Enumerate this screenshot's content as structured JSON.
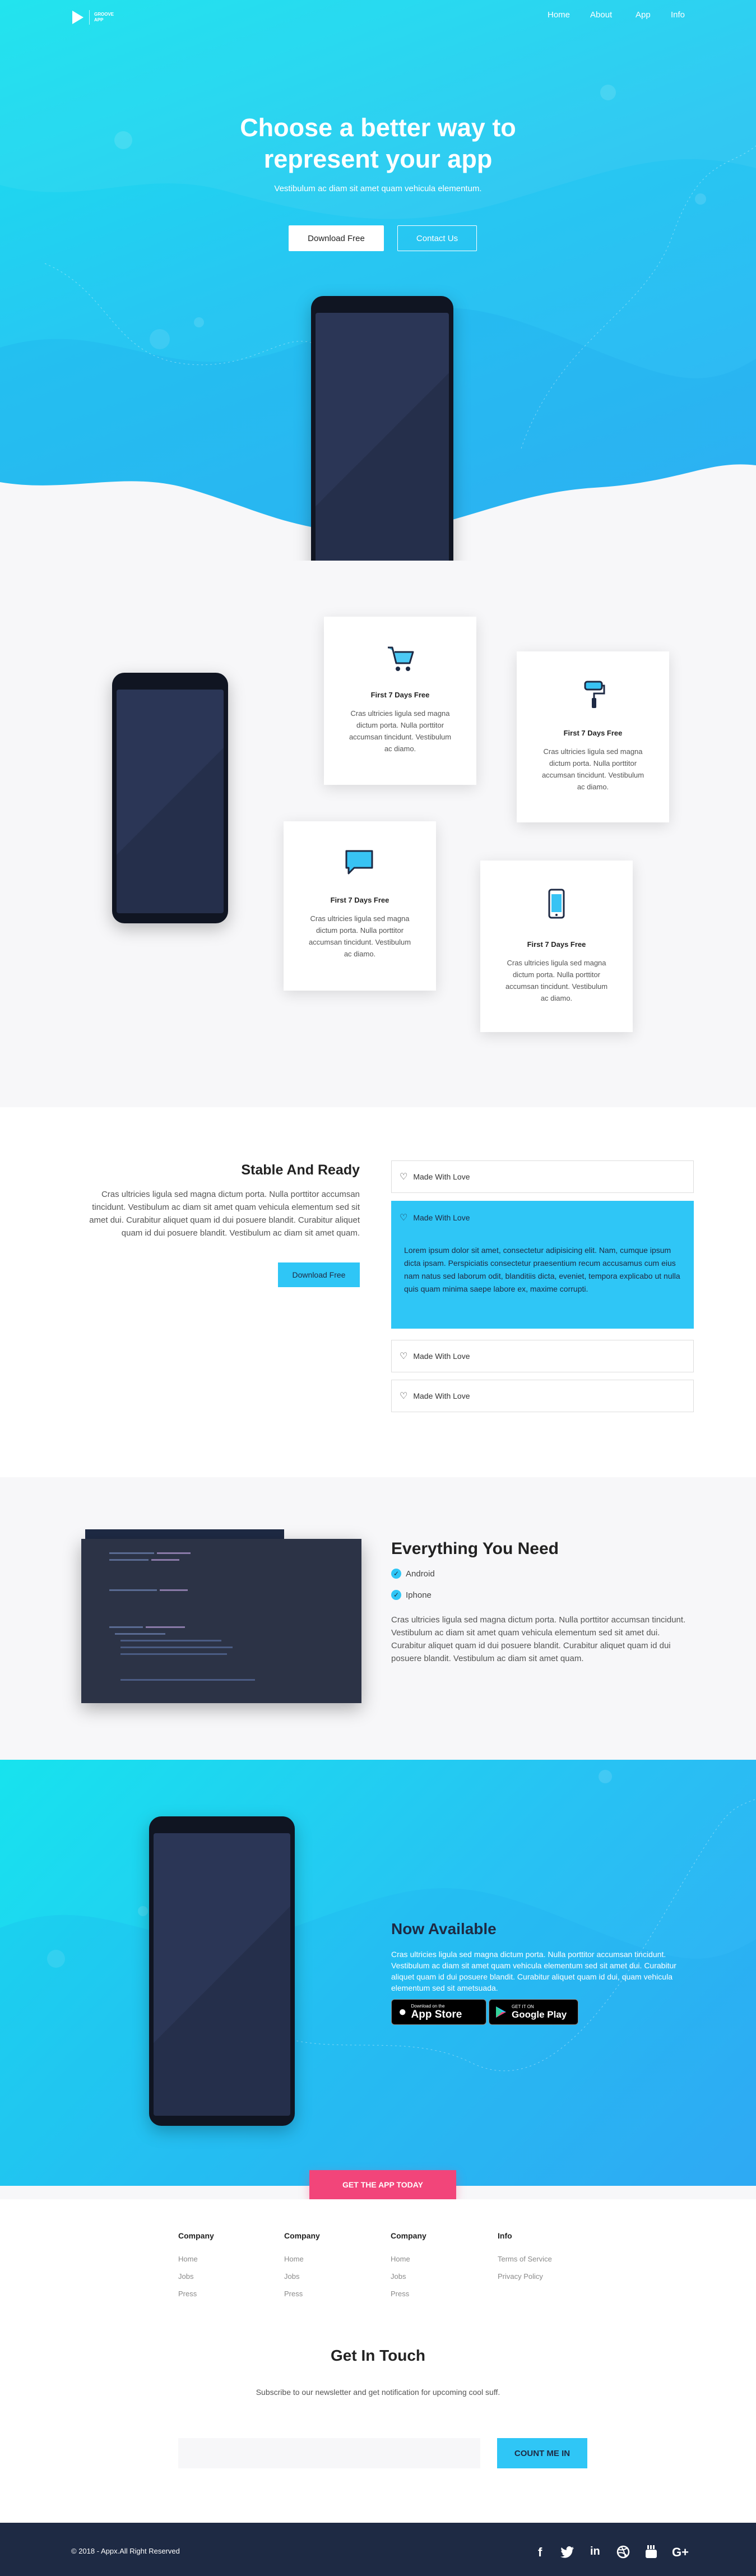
{
  "nav": {
    "logo_line1": "GROOVE",
    "logo_line2": "APP",
    "links": [
      "Home",
      "About",
      "App",
      "Info"
    ]
  },
  "hero": {
    "title_line1": "Choose a better way to",
    "title_line2": "represent your app",
    "subtitle": "Vestibulum ac diam sit amet quam vehicula elementum.",
    "btn_primary": "Download Free",
    "btn_secondary": "Contact Us"
  },
  "features": [
    {
      "icon": "cart-icon",
      "title": "First 7 Days Free",
      "text": "Cras ultricies ligula sed magna dictum porta. Nulla porttitor accumsan tincidunt. Vestibulum ac diamo."
    },
    {
      "icon": "paint-roller-icon",
      "title": "First 7 Days Free",
      "text": "Cras ultricies ligula sed magna dictum porta. Nulla porttitor accumsan tincidunt. Vestibulum ac diamo."
    },
    {
      "icon": "chat-icon",
      "title": "First 7 Days Free",
      "text": "Cras ultricies ligula sed magna dictum porta. Nulla porttitor accumsan tincidunt. Vestibulum ac diamo."
    },
    {
      "icon": "phone-icon",
      "title": "First 7 Days Free",
      "text": "Cras ultricies ligula sed magna dictum porta. Nulla porttitor accumsan tincidunt. Vestibulum ac diamo."
    }
  ],
  "stable": {
    "title": "Stable And Ready",
    "text": "Cras ultricies ligula sed magna dictum porta. Nulla porttitor accumsan tincidunt. Vestibulum ac diam sit amet quam vehicula elementum sed sit amet dui. Curabitur aliquet quam id dui posuere blandit. Curabitur aliquet quam id dui posuere blandit. Vestibulum ac diam sit amet quam.",
    "button": "Download Free"
  },
  "accordion": [
    {
      "label": "Made With Love"
    },
    {
      "label": "Made With Love",
      "body": "Lorem ipsum dolor sit amet, consectetur adipisicing elit. Nam, cumque ipsum dicta ipsam. Perspiciatis consectetur praesentium recum accusamus cum eius nam natus sed laborum odit, blanditiis dicta, eveniet, tempora explicabo ut nulla quis quam minima saepe labore ex, maxime corrupti."
    },
    {
      "label": "Made With Love"
    },
    {
      "label": "Made With Love"
    }
  ],
  "everything": {
    "title": "Everything You Need",
    "items": [
      "Android",
      "Iphone"
    ],
    "text": "Cras ultricies ligula sed magna dictum porta. Nulla porttitor accumsan tincidunt. Vestibulum ac diam sit amet quam vehicula elementum sed sit amet dui. Curabitur aliquet quam id dui posuere blandit. Curabitur aliquet quam id dui posuere blandit. Vestibulum ac diam sit amet quam."
  },
  "available": {
    "title": "Now Available",
    "text": "Cras ultricies ligula sed magna dictum porta. Nulla porttitor accumsan tincidunt. Vestibulum ac diam sit amet quam vehicula elementum sed sit amet dui. Curabitur aliquet quam id dui posuere blandit. Curabitur aliquet quam id dui, quam vehicula elementum sed sit ametsuada.",
    "appstore_small": "Download on the",
    "appstore_big": "App Store",
    "gplay_small": "GET IT ON",
    "gplay_big": "Google Play",
    "cta": "GET THE APP TODAY"
  },
  "footer_cols": [
    {
      "heading": "Company",
      "items": [
        "Home",
        "Jobs",
        "Press"
      ]
    },
    {
      "heading": "Company",
      "items": [
        "Home",
        "Jobs",
        "Press"
      ]
    },
    {
      "heading": "Company",
      "items": [
        "Home",
        "Jobs",
        "Press"
      ]
    },
    {
      "heading": "Info",
      "items": [
        "Terms of Service",
        "Privacy Policy"
      ]
    }
  ],
  "newsletter": {
    "title": "Get In Touch",
    "subtitle": "Subscribe to our newsletter and get notification for upcoming cool suff.",
    "placeholder": "",
    "button": "COUNT ME IN"
  },
  "bottom": {
    "copyright": "© 2018 - Appx.All Right Reserved",
    "social": [
      "facebook-icon",
      "twitter-icon",
      "linkedin-icon",
      "dribbble-icon",
      "youtube-icon",
      "google-plus-icon"
    ]
  },
  "colors": {
    "accent": "#2fc6f6",
    "dark": "#1e2a44",
    "cta": "#f2457a"
  }
}
